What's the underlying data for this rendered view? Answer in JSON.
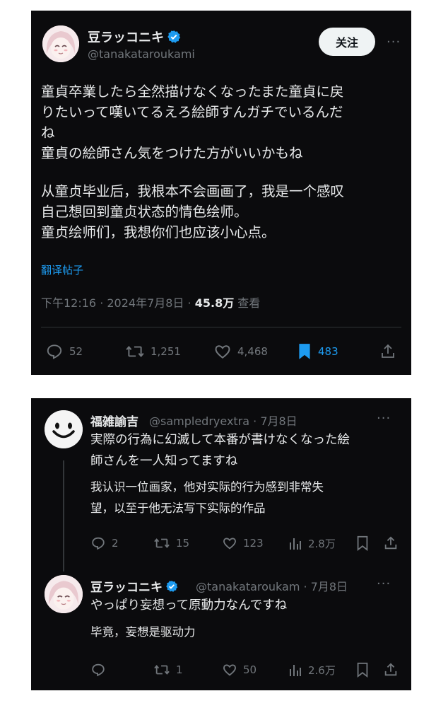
{
  "tweet": {
    "author_name": "豆ラッコニキ",
    "handle": "@tanakataroukami",
    "follow_label": "关注",
    "more_label": "···",
    "text_jp": [
      "童貞卒業したら全然描けなくなったまた童貞に戻",
      "りたいって嘆いてるえろ絵師すんガチでいるんだ",
      "ね",
      "童貞の絵師さん気をつけた方がいいかもね"
    ],
    "text_cn": [
      "从童贞毕业后，我根本不会画画了，我是一个感叹",
      "自己想回到童贞状态的情色绘师。",
      "童贞绘师们，我想你们也应该小心点。"
    ],
    "translate_label": "翻译帖子",
    "time": "下午12:16 · 2024年7月8日 · ",
    "views": "45.8万",
    "views_label": " 查看",
    "stats": {
      "replies": "52",
      "retweets": "1,251",
      "likes": "4,468",
      "bookmarks": "483"
    },
    "colors": {
      "accent": "#1d9bf0",
      "background": "#0b0b0d"
    }
  },
  "reply1": {
    "author_name": "福雑諭吉",
    "handle_date": "@sampledryextra · 7月8日",
    "text_jp": [
      "実際の行為に幻滅して本番が書けなくなった絵",
      "師さんを一人知ってますね"
    ],
    "text_cn": [
      "我认识一位画家，他对实际的行为感到非常失",
      "望，以至于他无法写下实际的作品"
    ],
    "stats": {
      "replies": "2",
      "retweets": "15",
      "likes": "123",
      "views": "2.8万"
    }
  },
  "reply2": {
    "author_name": "豆ラッコニキ",
    "handle_date": "@tanakataroukam · 7月8日",
    "text_jp": [
      "やっぱり妄想って原動力なんですね"
    ],
    "text_cn": [
      "毕竟，妄想是驱动力"
    ],
    "stats": {
      "replies": "",
      "retweets": "1",
      "likes": "50",
      "views": "2.6万"
    }
  }
}
